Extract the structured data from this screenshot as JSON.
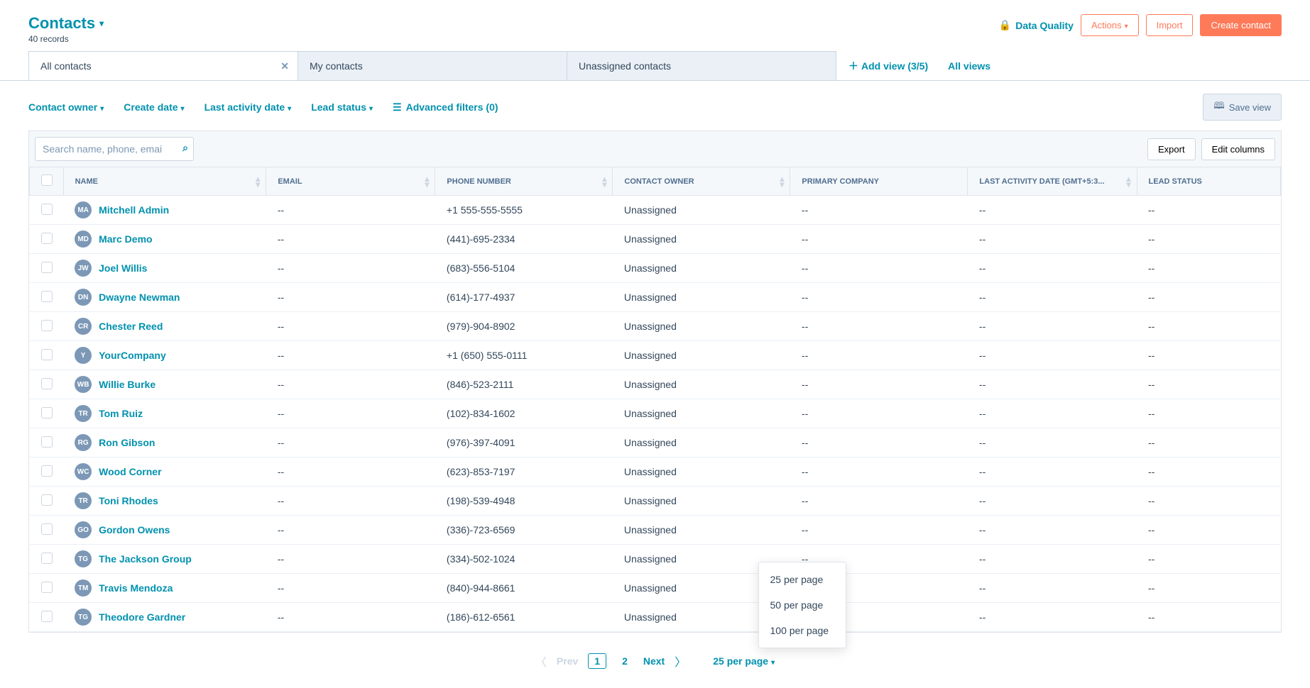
{
  "header": {
    "title": "Contacts",
    "records": "40 records",
    "dataQuality": "Data Quality",
    "actions": "Actions",
    "import": "Import",
    "create": "Create contact"
  },
  "tabs": {
    "items": [
      {
        "label": "All contacts",
        "active": true,
        "closable": true
      },
      {
        "label": "My contacts",
        "active": false,
        "closable": false
      },
      {
        "label": "Unassigned contacts",
        "active": false,
        "closable": false
      }
    ],
    "addView": "Add view (3/5)",
    "allViews": "All views"
  },
  "filters": {
    "contactOwner": "Contact owner",
    "createDate": "Create date",
    "lastActivity": "Last activity date",
    "leadStatus": "Lead status",
    "advanced": "Advanced filters (0)",
    "saveView": "Save view"
  },
  "toolbar": {
    "searchPlaceholder": "Search name, phone, emai",
    "export": "Export",
    "editColumns": "Edit columns"
  },
  "columns": {
    "name": "NAME",
    "email": "EMAIL",
    "phone": "PHONE NUMBER",
    "owner": "CONTACT OWNER",
    "company": "PRIMARY COMPANY",
    "activity": "LAST ACTIVITY DATE (GMT+5:3...",
    "lead": "LEAD STATUS"
  },
  "rows": [
    {
      "initials": "MA",
      "name": "Mitchell Admin",
      "email": "--",
      "phone": "+1 555-555-5555",
      "owner": "Unassigned",
      "company": "--",
      "activity": "--",
      "lead": "--"
    },
    {
      "initials": "MD",
      "name": "Marc Demo",
      "email": "--",
      "phone": "(441)-695-2334",
      "owner": "Unassigned",
      "company": "--",
      "activity": "--",
      "lead": "--"
    },
    {
      "initials": "JW",
      "name": "Joel Willis",
      "email": "--",
      "phone": "(683)-556-5104",
      "owner": "Unassigned",
      "company": "--",
      "activity": "--",
      "lead": "--"
    },
    {
      "initials": "DN",
      "name": "Dwayne Newman",
      "email": "--",
      "phone": "(614)-177-4937",
      "owner": "Unassigned",
      "company": "--",
      "activity": "--",
      "lead": "--"
    },
    {
      "initials": "CR",
      "name": "Chester Reed",
      "email": "--",
      "phone": "(979)-904-8902",
      "owner": "Unassigned",
      "company": "--",
      "activity": "--",
      "lead": "--"
    },
    {
      "initials": "Y",
      "name": "YourCompany",
      "email": "--",
      "phone": "+1 (650) 555-0111",
      "owner": "Unassigned",
      "company": "--",
      "activity": "--",
      "lead": "--"
    },
    {
      "initials": "WB",
      "name": "Willie Burke",
      "email": "--",
      "phone": "(846)-523-2111",
      "owner": "Unassigned",
      "company": "--",
      "activity": "--",
      "lead": "--"
    },
    {
      "initials": "TR",
      "name": "Tom Ruiz",
      "email": "--",
      "phone": "(102)-834-1602",
      "owner": "Unassigned",
      "company": "--",
      "activity": "--",
      "lead": "--"
    },
    {
      "initials": "RG",
      "name": "Ron Gibson",
      "email": "--",
      "phone": "(976)-397-4091",
      "owner": "Unassigned",
      "company": "--",
      "activity": "--",
      "lead": "--"
    },
    {
      "initials": "WC",
      "name": "Wood Corner",
      "email": "--",
      "phone": "(623)-853-7197",
      "owner": "Unassigned",
      "company": "--",
      "activity": "--",
      "lead": "--"
    },
    {
      "initials": "TR",
      "name": "Toni Rhodes",
      "email": "--",
      "phone": "(198)-539-4948",
      "owner": "Unassigned",
      "company": "--",
      "activity": "--",
      "lead": "--"
    },
    {
      "initials": "GO",
      "name": "Gordon Owens",
      "email": "--",
      "phone": "(336)-723-6569",
      "owner": "Unassigned",
      "company": "--",
      "activity": "--",
      "lead": "--"
    },
    {
      "initials": "TG",
      "name": "The Jackson Group",
      "email": "--",
      "phone": "(334)-502-1024",
      "owner": "Unassigned",
      "company": "--",
      "activity": "--",
      "lead": "--"
    },
    {
      "initials": "TM",
      "name": "Travis Mendoza",
      "email": "--",
      "phone": "(840)-944-8661",
      "owner": "Unassigned",
      "company": "--",
      "activity": "--",
      "lead": "--"
    },
    {
      "initials": "TG",
      "name": "Theodore Gardner",
      "email": "--",
      "phone": "(186)-612-6561",
      "owner": "Unassigned",
      "company": "--",
      "activity": "--",
      "lead": "--"
    }
  ],
  "pagination": {
    "prev": "Prev",
    "pages": [
      "1",
      "2"
    ],
    "current": "1",
    "next": "Next",
    "perPage": "25 per page",
    "options": [
      "25 per page",
      "50 per page",
      "100 per page"
    ]
  }
}
